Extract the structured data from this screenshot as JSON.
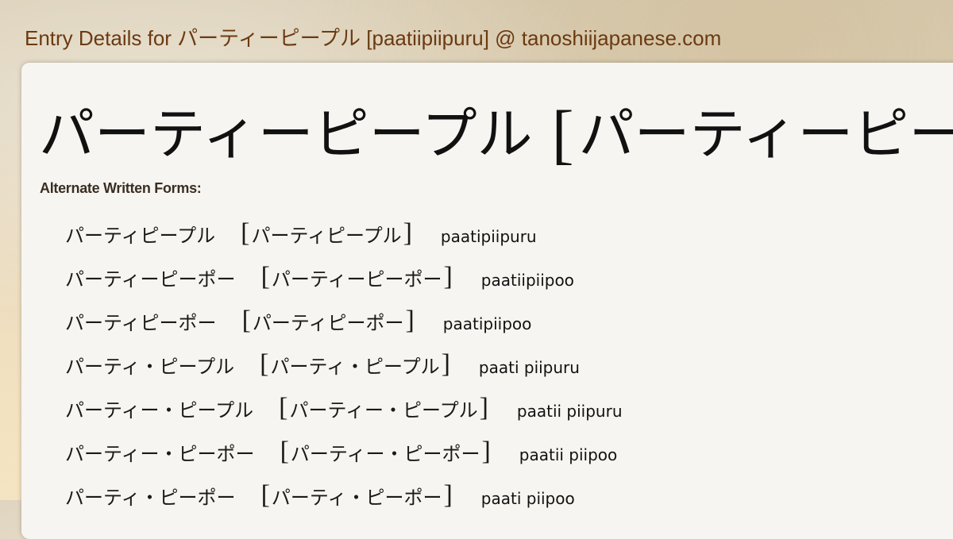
{
  "header": {
    "title": "Entry Details for パーティーピープル [paatiipiipuru] @ tanoshiijapanese.com"
  },
  "entry": {
    "word": "パーティーピープル",
    "reading_kana": "パーティーピープ"
  },
  "alternate_forms": {
    "label": "Alternate Written Forms:",
    "items": [
      {
        "written": "パーティピープル",
        "kana": "パーティピープル",
        "romaji": "paatipiipuru"
      },
      {
        "written": "パーティーピーポー",
        "kana": "パーティーピーポー",
        "romaji": "paatiipiipoo"
      },
      {
        "written": "パーティピーポー",
        "kana": "パーティピーポー",
        "romaji": "paatipiipoo"
      },
      {
        "written": "パーティ・ピープル",
        "kana": "パーティ・ピープル",
        "romaji": "paati piipuru"
      },
      {
        "written": "パーティー・ピープル",
        "kana": "パーティー・ピープル",
        "romaji": "paatii piipuru"
      },
      {
        "written": "パーティー・ピーポー",
        "kana": "パーティー・ピーポー",
        "romaji": "paatii piipoo"
      },
      {
        "written": "パーティ・ピーポー",
        "kana": "パーティ・ピーポー",
        "romaji": "paati piipoo"
      }
    ]
  }
}
